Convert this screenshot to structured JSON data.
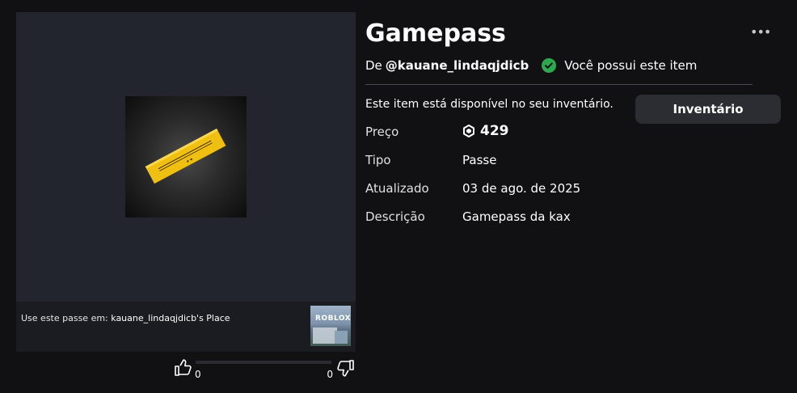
{
  "item": {
    "title": "Gamepass",
    "by_prefix": "De",
    "creator": "@kauane_lindaqjdicb",
    "owned_text": "Você possui este item",
    "availability": "Este item está disponível no seu inventário.",
    "inventory_button": "Inventário",
    "more_label": "•••"
  },
  "details": {
    "price_label": "Preço",
    "price_value": "429",
    "type_label": "Tipo",
    "type_value": "Passe",
    "updated_label": "Atualizado",
    "updated_value": "03 de ago. de 2025",
    "description_label": "Descrição",
    "description_value": "Gamepass da kax"
  },
  "place": {
    "prefix": "Use este passe em:",
    "name": "kauane_lindaqjdicb's Place",
    "thumb_logo": "ROBLOX"
  },
  "votes": {
    "up": "0",
    "down": "0"
  },
  "colors": {
    "background": "#111114",
    "panel": "#22252d",
    "owned_check": "#2ea84e",
    "ticket": "#f0c010"
  }
}
